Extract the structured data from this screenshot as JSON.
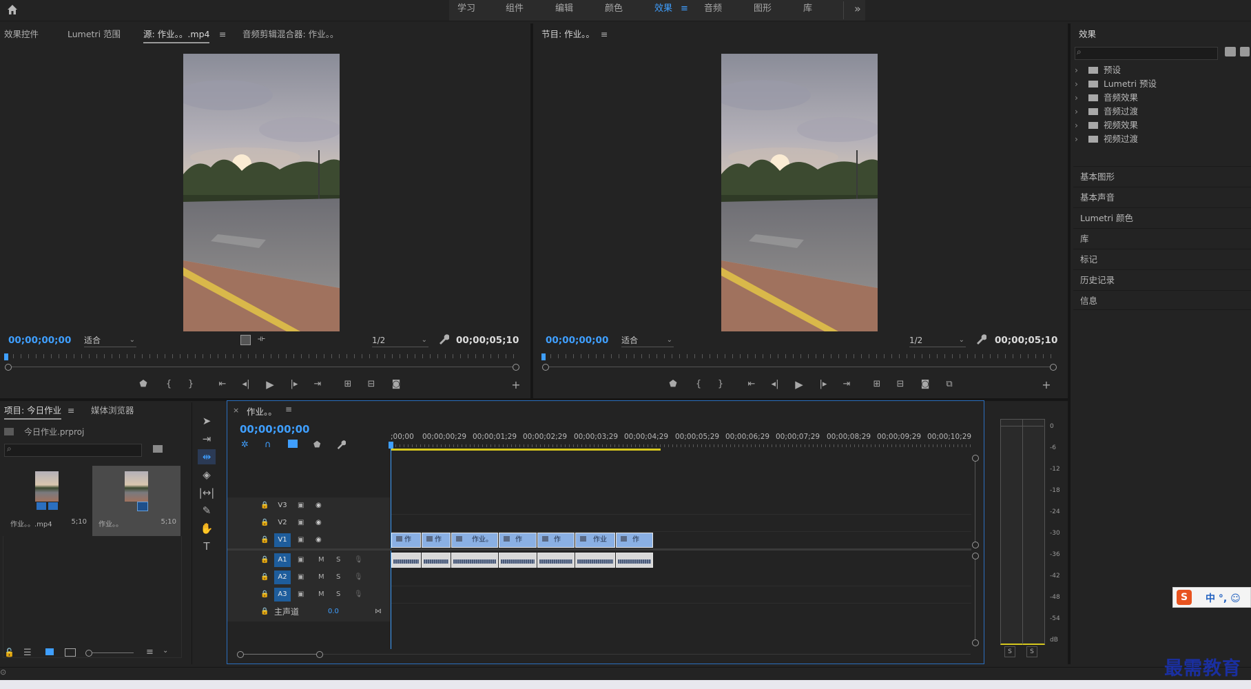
{
  "workspace": {
    "home_icon": "home-icon",
    "tabs": [
      "学习",
      "组件",
      "编辑",
      "颜色",
      "效果",
      "音频",
      "图形",
      "库"
    ],
    "active_tab": "效果",
    "active_menu_glyph": "≡",
    "more": "»"
  },
  "source_panel": {
    "tabs": [
      "效果控件",
      "Lumetri 范围",
      "源: 作业。。.mp4",
      "音频剪辑混合器: 作业。。"
    ],
    "active_tab_index": 2,
    "menu_glyph": "≡",
    "timecode": "00;00;00;00",
    "fit": "适合",
    "resolution": "1/2",
    "duration": "00;00;05;10"
  },
  "program_panel": {
    "title": "节目: 作业。。",
    "menu_glyph": "≡",
    "timecode": "00;00;00;00",
    "fit": "适合",
    "resolution": "1/2",
    "duration": "00;00;05;10"
  },
  "effects_panel": {
    "title": "效果",
    "search_placeholder": "",
    "folders": [
      "预设",
      "Lumetri 预设",
      "音频效果",
      "音频过渡",
      "视频效果",
      "视频过渡"
    ],
    "sections": [
      "基本图形",
      "基本声音",
      "Lumetri 颜色",
      "库",
      "标记",
      "历史记录",
      "信息"
    ]
  },
  "project_panel": {
    "tabs": [
      "项目: 今日作业",
      "媒体浏览器"
    ],
    "menu_glyph": "≡",
    "file": "今日作业.prproj",
    "search_placeholder": "",
    "items": [
      {
        "name": "作业。。.mp4",
        "duration": "5;10"
      },
      {
        "name": "作业。。",
        "duration": "5;10"
      }
    ]
  },
  "timeline": {
    "close": "×",
    "title": "作业。。",
    "menu_glyph": "≡",
    "timecode": "00;00;00;00",
    "ruler": [
      ";00;00",
      "00;00;00;29",
      "00;00;01;29",
      "00;00;02;29",
      "00;00;03;29",
      "00;00;04;29",
      "00;00;05;29",
      "00;00;06;29",
      "00;00;07;29",
      "00;00;08;29",
      "00;00;09;29",
      "00;00;10;29"
    ],
    "tracks": {
      "video": [
        "V3",
        "V2",
        "V1"
      ],
      "audio": [
        "A1",
        "A2",
        "A3"
      ],
      "master": "主声道",
      "master_value": "0.0",
      "mute": "M",
      "solo": "S"
    },
    "video_clips": [
      "作",
      "作",
      "作业。",
      "作",
      "作",
      "作业",
      "作"
    ],
    "audio_clip_count": 7
  },
  "audio_meter": {
    "labels": [
      "0",
      "-6",
      "-12",
      "-18",
      "-24",
      "-30",
      "-36",
      "-42",
      "-48",
      "-54",
      "dB"
    ],
    "solo_buttons": [
      "S",
      "S"
    ]
  },
  "ime": {
    "label": "中 °, ☺"
  },
  "watermark": "最需教育",
  "colors": {
    "accent": "#3f9fff",
    "clip_video": "#8ab0e4",
    "clip_audio": "#d8d8d8",
    "work_area": "#d7c81e",
    "panel": "#232323",
    "track_on": "#1e5d9c"
  }
}
